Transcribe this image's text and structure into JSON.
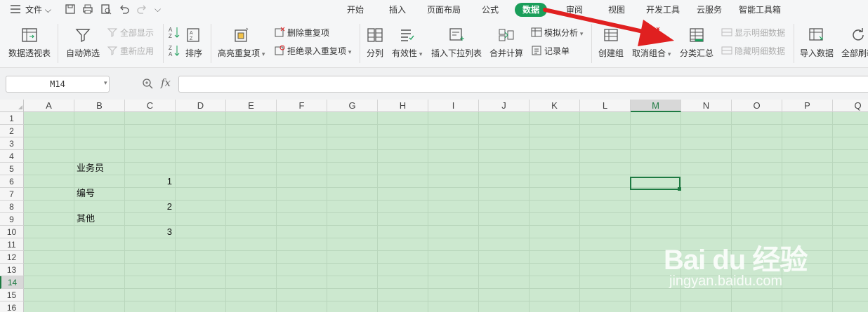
{
  "menu": {
    "file_label": "文件",
    "tabs": [
      {
        "label": "开始"
      },
      {
        "label": "插入"
      },
      {
        "label": "页面布局"
      },
      {
        "label": "公式"
      },
      {
        "label": "数据",
        "active": true
      },
      {
        "label": "审阅"
      },
      {
        "label": "视图"
      },
      {
        "label": "开发工具"
      },
      {
        "label": "云服务"
      },
      {
        "label": "智能工具箱"
      }
    ]
  },
  "ribbon": {
    "pivot": "数据透视表",
    "autofilter": "自动筛选",
    "show_all": "全部显示",
    "reapply": "重新应用",
    "sort": "排序",
    "highlight_dup": "高亮重复项",
    "remove_dup": "删除重复项",
    "reject_dup": "拒绝录入重复项",
    "split": "分列",
    "validity": "有效性",
    "dropdown": "插入下拉列表",
    "consolidate": "合并计算",
    "whatif": "模拟分析",
    "record": "记录单",
    "group": "创建组",
    "ungroup": "取消组合",
    "subtotal": "分类汇总",
    "show_detail": "显示明细数据",
    "hide_detail": "隐藏明细数据",
    "import": "导入数据",
    "refresh": "全部刷新"
  },
  "formula_bar": {
    "name_box": "M14",
    "fx": "fx",
    "content": ""
  },
  "sheet": {
    "columns": [
      "A",
      "B",
      "C",
      "D",
      "E",
      "F",
      "G",
      "H",
      "I",
      "J",
      "K",
      "L",
      "M",
      "N",
      "O",
      "P",
      "Q"
    ],
    "selected_column": "M",
    "rows": [
      "1",
      "2",
      "3",
      "4",
      "5",
      "6",
      "7",
      "8",
      "9",
      "10",
      "11",
      "12",
      "13",
      "14",
      "15",
      "16"
    ],
    "selected_row": "14",
    "cells": {
      "B5": "业务员",
      "C6": "1",
      "B7": "编号",
      "C8": "2",
      "B9": "其他",
      "C10": "3"
    }
  },
  "watermark": {
    "brand": "Bai du 经验",
    "url": "jingyan.baidu.com"
  },
  "colors": {
    "accent": "#1a9e5a",
    "sheet_bg": "#cce8cf",
    "arrow": "#e02020"
  }
}
